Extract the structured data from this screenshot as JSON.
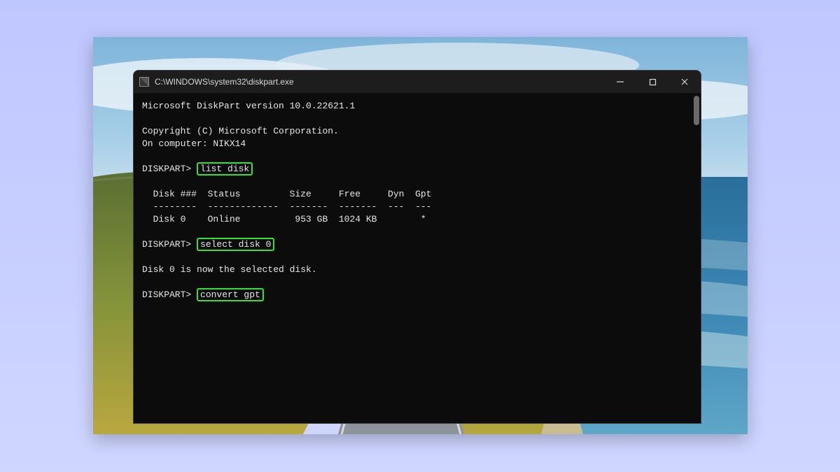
{
  "window": {
    "title": "C:\\WINDOWS\\system32\\diskpart.exe"
  },
  "terminal": {
    "version_line": "Microsoft DiskPart version 10.0.22621.1",
    "copyright_line": "Copyright (C) Microsoft Corporation.",
    "computer_line": "On computer: NIKX14",
    "prompt": "DISKPART> ",
    "cmd1": "list disk",
    "list_header": "  Disk ###  Status         Size     Free     Dyn  Gpt",
    "list_divider": "  --------  -------------  -------  -------  ---  ---",
    "list_row0": "  Disk 0    Online          953 GB  1024 KB        *",
    "cmd2": "select disk 0",
    "selected_msg": "Disk 0 is now the selected disk.",
    "cmd3": "convert gpt"
  }
}
